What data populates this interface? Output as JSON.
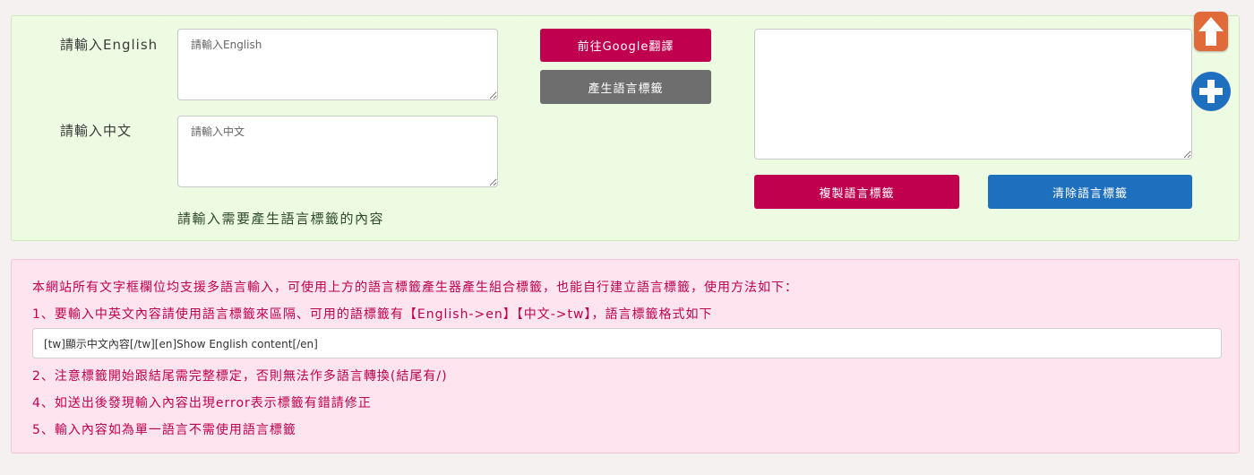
{
  "generator": {
    "english_label": "請輸入English",
    "english_placeholder": "請輸入English",
    "chinese_label": "請輸入中文",
    "chinese_placeholder": "請輸入中文",
    "hint": "請輸入需要產生語言標籤的內容",
    "google_button": "前往Google翻譯",
    "generate_button": "產生語言標籤",
    "output_value": "",
    "copy_button": "複製語言標籤",
    "clear_button": "清除語言標籤"
  },
  "floating": {
    "up_icon": "arrow-up-icon",
    "plus_icon": "plus-circle-icon"
  },
  "instructions": {
    "intro": "本網站所有文字框欄位均支援多語言輸入，可使用上方的語言標籤產生器產生組合標籤，也能自行建立語言標籤，使用方法如下：",
    "item1": "1、要輸入中英文內容請使用語言標籤來區隔、可用的語標籤有【English->en】【中文->tw】，語言標籤格式如下",
    "example": "[tw]顯示中文內容[/tw][en]Show English content[/en]",
    "item2": "2、注意標籤開始跟結尾需完整標定，否則無法作多語言轉換(結尾有/)",
    "item4": "4、如送出後發現輸入內容出現error表示標籤有錯請修正",
    "item5": "5、輸入內容如為單一語言不需使用語言標籤"
  },
  "colors": {
    "accent_red": "#c0004f",
    "accent_blue": "#1f6fbf",
    "panel_green": "#edfbe3",
    "panel_pink": "#fde4ee"
  }
}
